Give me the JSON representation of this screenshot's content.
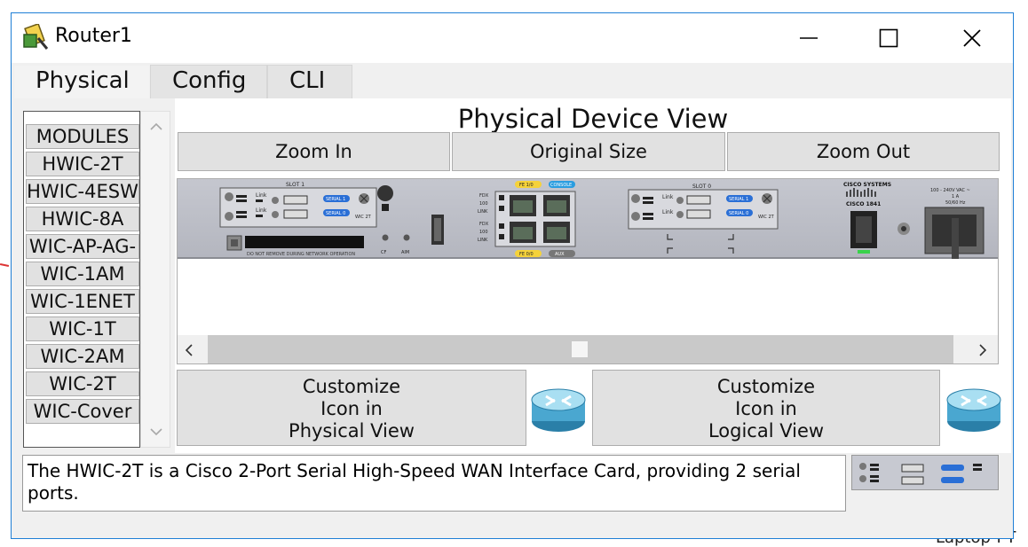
{
  "window": {
    "title": "Router1",
    "controls": [
      "minimize-icon",
      "maximize-icon",
      "close-icon"
    ]
  },
  "tabs": [
    {
      "label": "Physical",
      "active": true
    },
    {
      "label": "Config",
      "active": false
    },
    {
      "label": "CLI",
      "active": false
    }
  ],
  "modules": {
    "items": [
      "MODULES",
      "HWIC-2T",
      "HWIC-4ESW",
      "HWIC-8A",
      "WIC-AP-AG-",
      "WIC-1AM",
      "WIC-1ENET",
      "WIC-1T",
      "WIC-2AM",
      "WIC-2T",
      "WIC-Cover"
    ]
  },
  "device_view": {
    "title": "Physical Device View",
    "zoom_in": "Zoom In",
    "original_size": "Original Size",
    "zoom_out": "Zoom Out"
  },
  "chassis": {
    "slot1": "SLOT 1",
    "slot0": "SLOT 0",
    "serial1": "SERIAL 1",
    "serial0": "SERIAL 0",
    "link": "Link",
    "wic": "WIC 2T",
    "warning": "DO NOT REMOVE DURING NETWORK OPERATION",
    "cf": "CF",
    "aim": "AIM",
    "fe1": "FE 1/0",
    "fe0": "FE 0/0",
    "console": "CONSOLE",
    "aux": "AUX",
    "fdx": "FDX",
    "speed": "100",
    "linkcap": "LINK",
    "brand": "CISCO SYSTEMS",
    "model": "CISCO 1841",
    "power_line1": "100 - 240V VAC ~",
    "power_line2": "1 A",
    "power_line3": "50/60 Hz"
  },
  "customize": {
    "physical": [
      "Customize",
      "Icon in",
      "Physical View"
    ],
    "logical": [
      "Customize",
      "Icon in",
      "Logical View"
    ]
  },
  "description": "The HWIC-2T is a Cisco 2-Port Serial High-Speed WAN Interface Card, providing 2 serial ports.",
  "background": {
    "partial_label": "Laptop-PT"
  },
  "colors": {
    "accent_border": "#1f7fd6",
    "serial_label": "#2a6fd6",
    "fe_label": "#f5d23a",
    "console_label": "#2a9de0",
    "power_led": "#39d24a"
  }
}
